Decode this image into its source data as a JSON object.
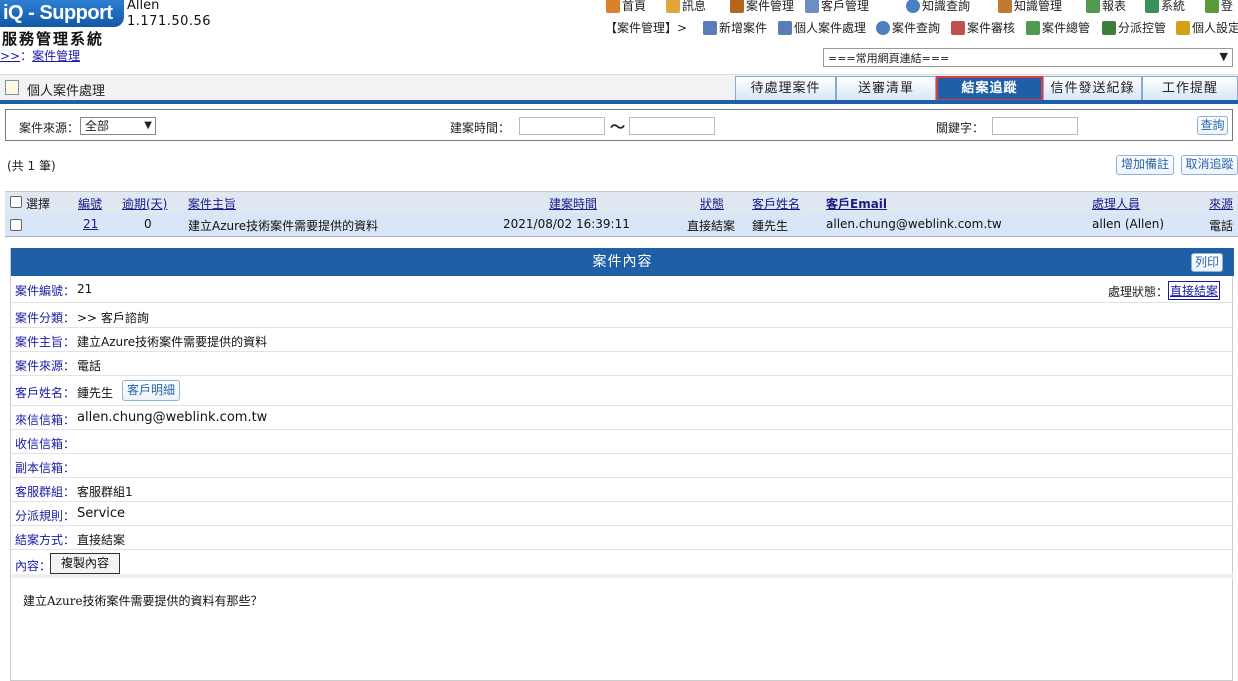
{
  "header": {
    "logo": "iQ - Support",
    "user_name": "Allen",
    "user_ip": "1.171.50.56",
    "system_title": "服務管理系統",
    "breadcrumb_prefix": ">>",
    "breadcrumb_sep": "：",
    "breadcrumb_current": "案件管理"
  },
  "topnav": [
    {
      "label": "首頁",
      "icon": "home-icon",
      "color": "#d9822b"
    },
    {
      "label": "訊息",
      "icon": "mail-icon",
      "color": "#e0a63a"
    },
    {
      "label": "案件管理",
      "icon": "case-icon",
      "color": "#b5651d"
    },
    {
      "label": "客戶管理",
      "icon": "customer-icon",
      "color": "#6b8fc4"
    },
    {
      "label": "知識查詢",
      "icon": "search-icon",
      "color": "#4a7fc1"
    },
    {
      "label": "知識管理",
      "icon": "book-icon",
      "color": "#c07a2f"
    },
    {
      "label": "報表",
      "icon": "report-icon",
      "color": "#4f9a4f"
    },
    {
      "label": "系統",
      "icon": "system-icon",
      "color": "#3b8f5a"
    },
    {
      "label": "登",
      "icon": "logout-icon",
      "color": "#5a9a3c"
    }
  ],
  "subnav": {
    "prefix": "【案件管理】>",
    "items": [
      {
        "label": "新增案件",
        "icon": "new-case-icon",
        "color": "#5a7db8"
      },
      {
        "label": "個人案件處理",
        "icon": "personal-case-icon",
        "color": "#5a7db8"
      },
      {
        "label": "案件查詢",
        "icon": "case-search-icon",
        "color": "#4a7fc1"
      },
      {
        "label": "案件審核",
        "icon": "case-review-icon",
        "color": "#c0504d"
      },
      {
        "label": "案件總管",
        "icon": "case-master-icon",
        "color": "#4f9a4f"
      },
      {
        "label": "分派控管",
        "icon": "dispatch-icon",
        "color": "#3b7f3b"
      },
      {
        "label": "個人設定",
        "icon": "personal-setting-icon",
        "color": "#d4a017"
      }
    ]
  },
  "quick_links": "===常用網頁連結===",
  "page_title": "個人案件處理",
  "tabs": [
    "待處理案件",
    "送審清單",
    "結案追蹤",
    "信件發送紀錄",
    "工作提醒"
  ],
  "search": {
    "source_label": "案件來源：",
    "source_value": "全部",
    "time_label": "建案時間：",
    "time_sep": "～",
    "keyword_label": "關鍵字：",
    "search_button": "查詢"
  },
  "count_text": "(共 1 筆)",
  "buttons": {
    "add_note": "增加備註",
    "cancel_track": "取消追蹤"
  },
  "table": {
    "headers": [
      "選擇",
      "編號",
      "逾期(天)",
      "案件主旨",
      "建案時間",
      "狀態",
      "客戶姓名",
      "客戶Email",
      "處理人員",
      "來源"
    ],
    "rows": [
      [
        "",
        "21",
        "0",
        "建立Azure技術案件需要提供的資料",
        "2021/08/02 16:39:11",
        "直接結案",
        "鍾先生",
        "allen.chung@weblink.com.tw",
        "allen (Allen)",
        "電話"
      ]
    ]
  },
  "detail": {
    "title": "案件內容",
    "print_button": "列印",
    "case_no_label": "案件編號：",
    "case_no": "21",
    "status_label": "處理狀態：",
    "status_value": "直接結案",
    "category_label": "案件分類：",
    "category": ">> 客戶諮詢",
    "subject_label": "案件主旨：",
    "subject": "建立Azure技術案件需要提供的資料",
    "source_label": "案件來源：",
    "source": "電話",
    "customer_label": "客戶姓名：",
    "customer": "鍾先生",
    "customer_detail_button": "客戶明細",
    "from_label": "來信信箱：",
    "from": "allen.chung@weblink.com.tw",
    "to_label": "收信信箱：",
    "cc_label": "副本信箱：",
    "group_label": "客服群組：",
    "group": "客服群組1",
    "rule_label": "分派規則：",
    "rule": "Service",
    "close_method_label": "結案方式：",
    "close_method": "直接結案",
    "content_label": "內容：",
    "copy_button": "複製內容",
    "content": "建立Azure技術案件需要提供的資料有那些？"
  }
}
